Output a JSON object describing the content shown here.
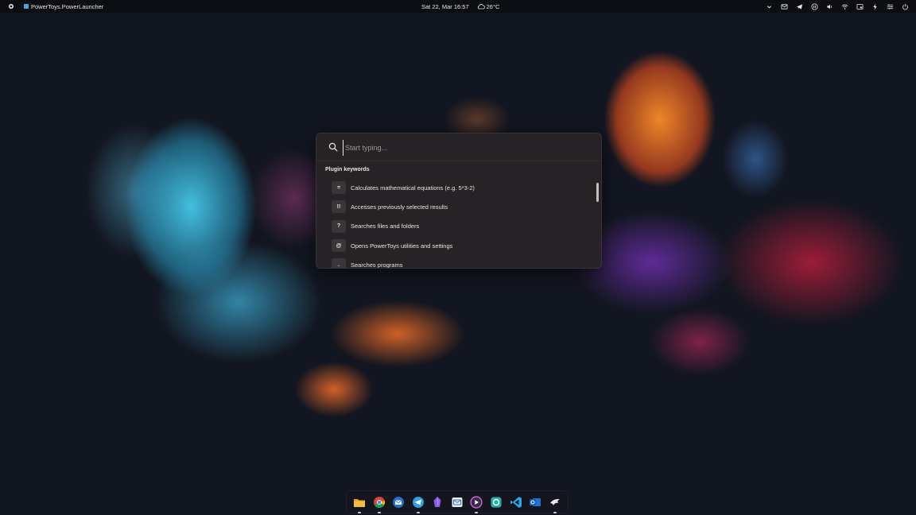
{
  "topbar": {
    "app_name": "PowerToys.PowerLauncher",
    "datetime": "Sat 22, Mar 16:57",
    "weather": "26°C",
    "left_icon": "activities-icon",
    "tray_icons": [
      "chevron-down-icon",
      "mail-icon",
      "telegram-icon",
      "media-pause-icon",
      "volume-icon",
      "wifi-icon",
      "screen-icon",
      "power-mode-icon",
      "settings-sliders-icon",
      "power-icon"
    ]
  },
  "launcher": {
    "search_placeholder": "Start typing...",
    "section_title": "Plugin keywords",
    "results": [
      {
        "key": "=",
        "text": "Calculates mathematical equations (e.g. 5*3-2)"
      },
      {
        "key": "!!",
        "text": "Accesses previously selected results"
      },
      {
        "key": "?",
        "text": "Searches files and folders"
      },
      {
        "key": "@",
        "text": "Opens PowerToys utilities and settings"
      },
      {
        "key": ".",
        "text": "Searches programs"
      }
    ]
  },
  "dock": {
    "apps": [
      "files-icon",
      "chrome-icon",
      "thunderbird-icon",
      "telegram-icon",
      "obsidian-icon",
      "mail-app-icon",
      "media-player-icon",
      "teams-chat-icon",
      "vscode-icon",
      "outlook-icon",
      "wine-icon"
    ]
  },
  "colors": {
    "topbar_bg": "#0b0d12",
    "launcher_bg": "#282426",
    "accent_blue": "#4aa3e0"
  }
}
